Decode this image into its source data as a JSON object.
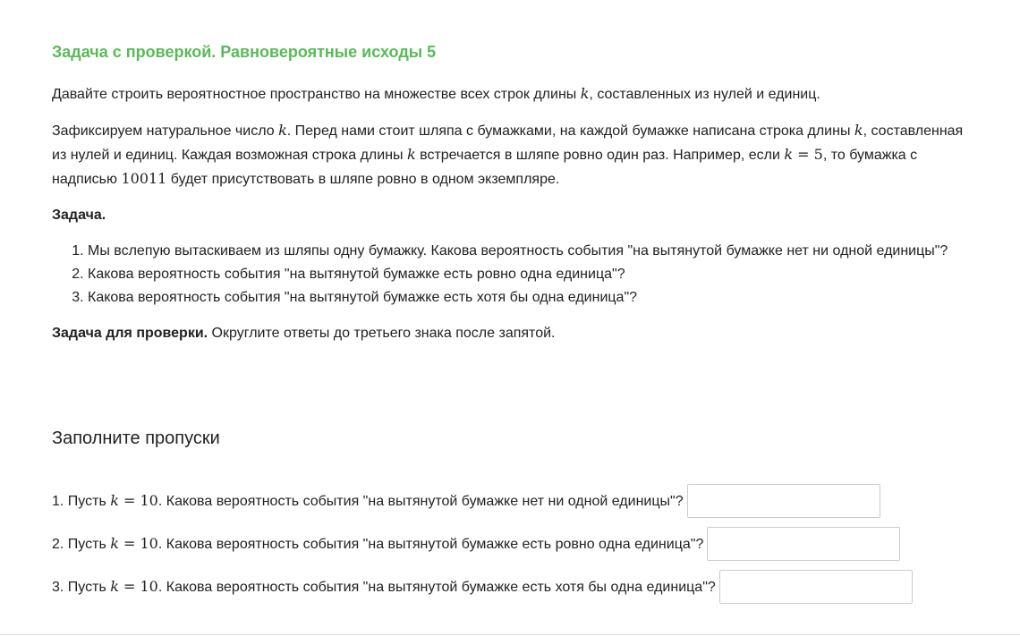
{
  "task": {
    "title": "Задача с проверкой. Равновероятные исходы 5",
    "intro_before_k": "Давайте строить вероятностное пространство на множестве всех строк длины ",
    "intro_k": "k",
    "intro_after_k": ", составленных из нулей и единиц.",
    "para2": {
      "t1": "Зафиксируем натуральное число ",
      "k1": "k",
      "t2": ". Перед нами стоит шляпа с бумажками, на каждой бумажке написана строка длины ",
      "k2": "k",
      "t3": ", составленная из нулей и единиц. Каждая возможная строка длины ",
      "k3": "k",
      "t4": " встречается в шляпе ровно один раз. Например, если ",
      "k4": "k",
      "eq": " = ",
      "five": "5",
      "t5": ", то бумажка с надписью ",
      "num": "10011",
      "t6": " будет присутствовать в шляпе ровно в одном экземпляре."
    },
    "task_label": "Задача.",
    "items": [
      "Мы вслепую вытаскиваем из шляпы одну бумажку. Какова вероятность события \"на вытянутой бумажке нет ни одной единицы\"?",
      "Какова вероятность события \"на вытянутой бумажке есть ровно одна единица\"?",
      "Какова вероятность события \"на вытянутой бумажке есть хотя бы одна единица\"?"
    ],
    "check_label": "Задача для проверки.",
    "check_text": " Округлите ответы до третьего знака после запятой."
  },
  "fill": {
    "title": "Заполните пропуски",
    "questions": [
      {
        "prefix": "1. Пусть ",
        "k": "k",
        "eq": " = ",
        "val": "10",
        "text": ". Какова вероятность события \"на вытянутой бумажке нет ни одной единицы\"?",
        "value": ""
      },
      {
        "prefix": "2. Пусть ",
        "k": "k",
        "eq": " = ",
        "val": "10",
        "text": ". Какова вероятность события \"на вытянутой бумажке есть ровно одна единица\"?",
        "value": ""
      },
      {
        "prefix": "3. Пусть ",
        "k": "k",
        "eq": " = ",
        "val": "10",
        "text": ". Какова вероятность события \"на вытянутой бумажке есть хотя бы одна единица\"?",
        "value": ""
      }
    ]
  },
  "colors": {
    "title_green": "#5cb85c",
    "text": "#222222",
    "input_border": "#cccccc"
  }
}
